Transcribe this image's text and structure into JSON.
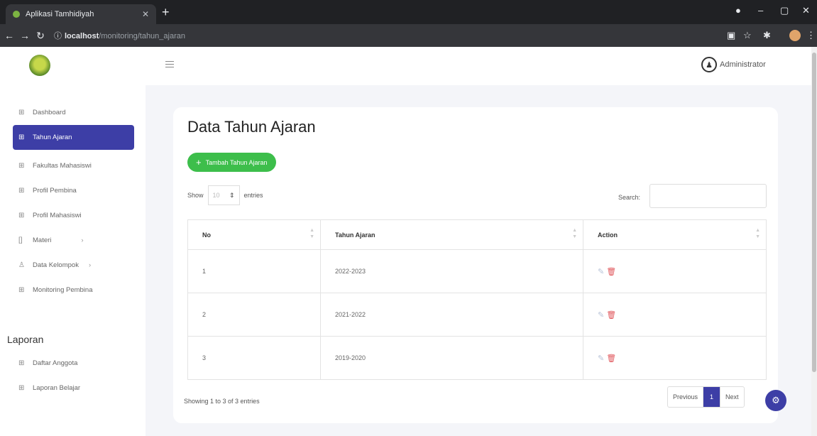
{
  "browser": {
    "tab_title": "Aplikasi Tamhidiyah",
    "url_host": "localhost",
    "url_path": "/monitoring/tahun_ajaran"
  },
  "header": {
    "user_name": "Administrator"
  },
  "sidebar": {
    "items": [
      {
        "label": "Dashboard",
        "icon": "grid-icon"
      },
      {
        "label": "Tahun Ajaran",
        "icon": "grid-icon"
      },
      {
        "label": "Fakultas Mahasiswi",
        "icon": "grid-icon"
      },
      {
        "label": "Profil Pembina",
        "icon": "grid-icon"
      },
      {
        "label": "Profil Mahasiswi",
        "icon": "grid-icon"
      },
      {
        "label": "Materi",
        "icon": "brackets-icon"
      },
      {
        "label": "Data Kelompok",
        "icon": "user-icon"
      },
      {
        "label": "Monitoring Pembina",
        "icon": "grid-icon"
      }
    ],
    "section_heading": "Laporan",
    "report_items": [
      {
        "label": "Daftar Anggota",
        "icon": "grid-icon"
      },
      {
        "label": "Laporan Belajar",
        "icon": "grid-icon"
      }
    ]
  },
  "main": {
    "title": "Data Tahun Ajaran",
    "add_button": "Tambah Tahun Ajaran",
    "show_label": "Show",
    "show_value": "10",
    "entries_label": "entries",
    "search_label": "Search:",
    "search_value": "",
    "columns": [
      "No",
      "Tahun Ajaran",
      "Action"
    ],
    "rows": [
      {
        "no": "1",
        "tahun": "2022-2023"
      },
      {
        "no": "2",
        "tahun": "2021-2022"
      },
      {
        "no": "3",
        "tahun": "2019-2020"
      }
    ],
    "info": "Showing 1 to 3 of 3 entries",
    "pagination": {
      "previous": "Previous",
      "current": "1",
      "next": "Next"
    }
  },
  "colors": {
    "primary": "#3d3ea6",
    "add_button": "#3dbe4b",
    "delete": "#e0565b"
  }
}
